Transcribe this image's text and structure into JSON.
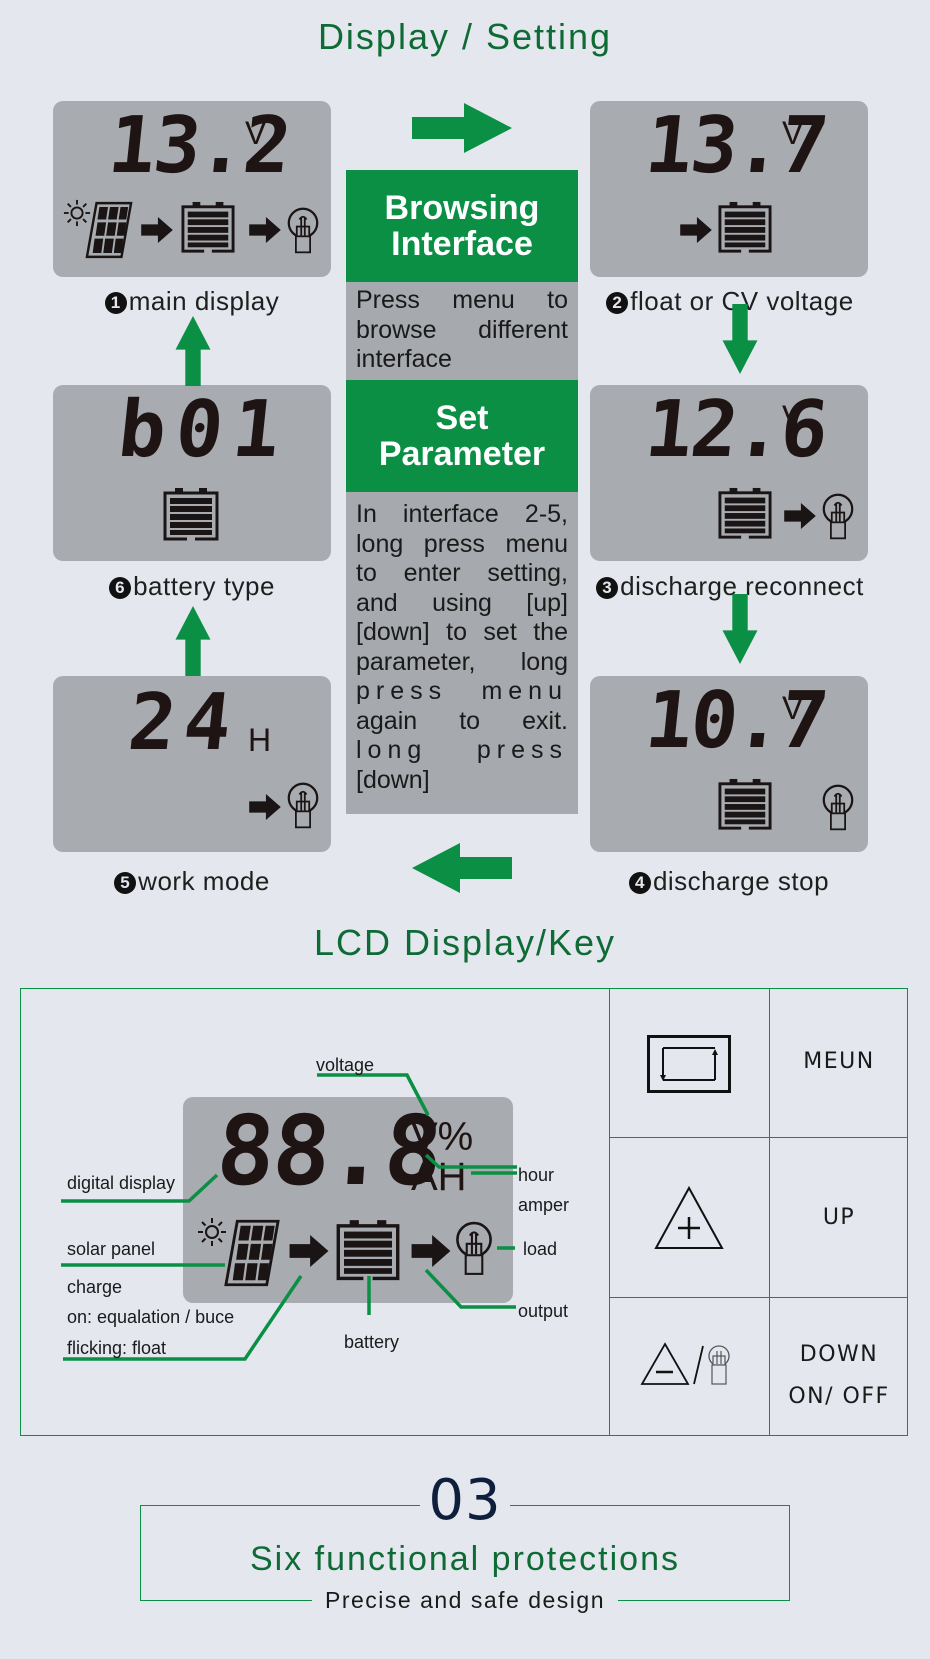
{
  "section1": {
    "title": "Display / Setting",
    "screens": [
      {
        "index": "1",
        "value": "13.2",
        "unit": "V",
        "caption": "main display",
        "icons": [
          "sun-icon",
          "solar-panel-icon",
          "arrow-right-icon",
          "battery-icon",
          "arrow-right-icon",
          "bulb-icon"
        ]
      },
      {
        "index": "2",
        "value": "13.7",
        "unit": "V",
        "caption": "float or CV voltage",
        "icons": [
          "arrow-right-icon",
          "battery-icon"
        ]
      },
      {
        "index": "3",
        "value": "12.6",
        "unit": "V",
        "caption": "discharge reconnect",
        "icons": [
          "battery-icon",
          "arrow-right-icon",
          "bulb-icon"
        ]
      },
      {
        "index": "4",
        "value": "10.7",
        "unit": "V",
        "caption": "discharge stop",
        "icons": [
          "battery-icon",
          "bulb-icon"
        ]
      },
      {
        "index": "5",
        "value": "24",
        "unit": "H",
        "caption": "work mode",
        "icons": [
          "arrow-right-icon",
          "bulb-icon"
        ]
      },
      {
        "index": "6",
        "value": "b01",
        "unit": "",
        "caption": "battery type",
        "icons": [
          "battery-icon"
        ]
      }
    ],
    "browsing": {
      "title_line1": "Browsing",
      "title_line2": "Interface",
      "text_lines": [
        "Press menu to",
        "browse different",
        "interface"
      ]
    },
    "set_parameter": {
      "title_line1": "Set",
      "title_line2": "Parameter",
      "text_lines": [
        "In interface 2-5,",
        "long press menu",
        "to enter setting,",
        "and using [up]",
        "[down] to set the",
        "parameter, long",
        "press menu",
        "again to exit.",
        "long press",
        "[down]"
      ]
    }
  },
  "section2": {
    "title": "LCD Display/Key",
    "lcd": {
      "digits": "88.8",
      "unit_top": "V%",
      "unit_bottom": "AH"
    },
    "annotations": {
      "voltage": "voltage",
      "digital_display": "digital display",
      "hour": "hour",
      "amper": "amper",
      "solar_panel": "solar panel",
      "load": "load",
      "charge": "charge",
      "charge_on": "on: equalation / buce",
      "charge_flick": "flicking: float",
      "output": "output",
      "battery": "battery"
    },
    "keys": [
      {
        "icon": "menu-cycle-icon",
        "label_lines": [
          "MEUN"
        ]
      },
      {
        "icon": "up-triangle-plus-icon",
        "label_lines": [
          "UP"
        ]
      },
      {
        "icon": "down-triangle-minus-bulb-icon",
        "label_lines": [
          "DOWN",
          "ON/ OFF"
        ]
      }
    ]
  },
  "section3": {
    "number": "03",
    "title": "Six functional protections",
    "subtitle": "Precise and safe design"
  },
  "colors": {
    "green": "#0a8f45",
    "dark_green_text": "#0f6b35",
    "lcd_gray": "#a8abaf",
    "background": "#e4e8ee",
    "navy": "#0e1f3c"
  }
}
